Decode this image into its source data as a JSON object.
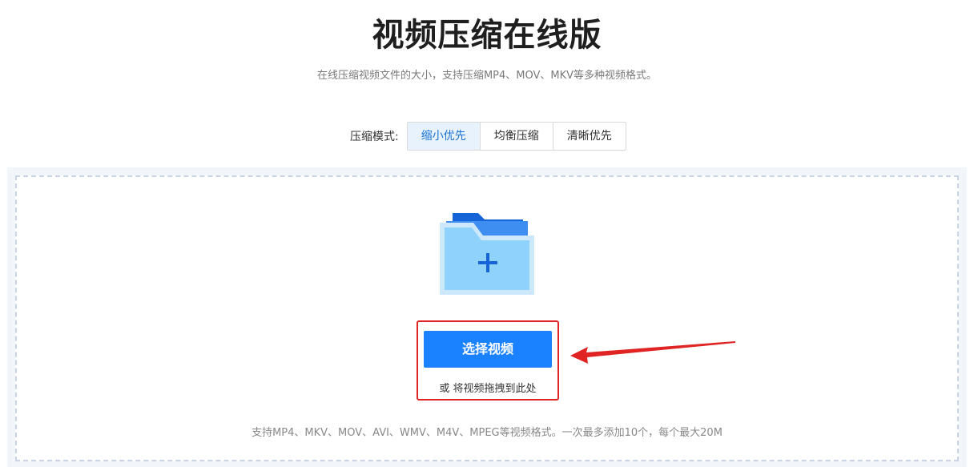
{
  "header": {
    "title": "视频压缩在线版",
    "subtitle": "在线压缩视频文件的大小，支持压缩MP4、MOV、MKV等多种视频格式。"
  },
  "compression_mode": {
    "label": "压缩模式:",
    "options": [
      "缩小优先",
      "均衡压缩",
      "清晰优先"
    ],
    "selected": "缩小优先"
  },
  "upload": {
    "folder_icon": "folder-plus-icon",
    "select_button_label": "选择视频",
    "drag_hint": "或 将视频拖拽到此处",
    "formats_note": "支持MP4、MKV、MOV、AVI、WMV、M4V、MPEG等视频格式。一次最多添加10个，每个最大20M"
  },
  "annotation": {
    "box_color": "#e02323",
    "arrow_color": "#e02323"
  },
  "colors": {
    "accent": "#1a82ff",
    "active_tab_bg": "#e8f2fd",
    "active_tab_text": "#1a73d4",
    "panel_bg": "#f2f5fa"
  }
}
